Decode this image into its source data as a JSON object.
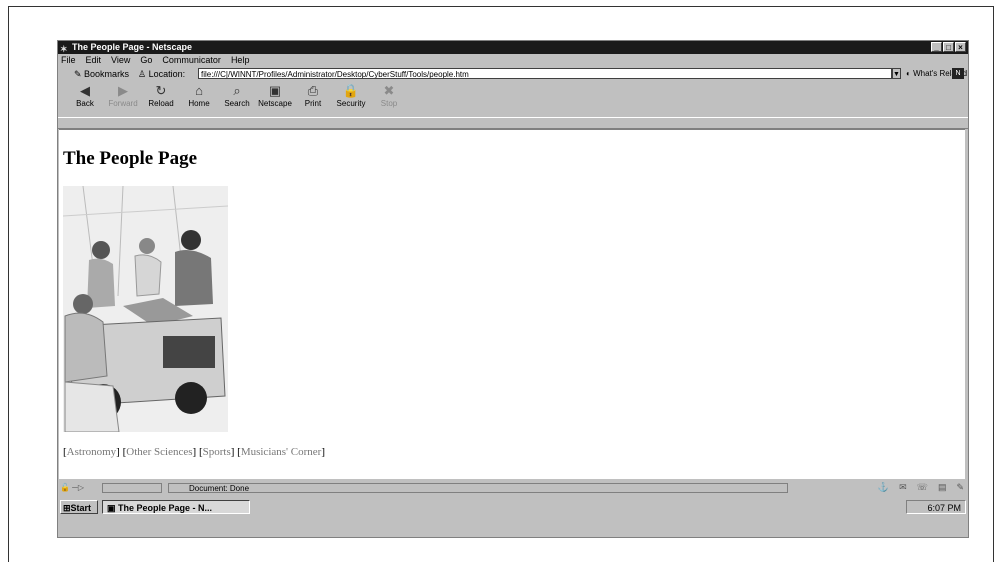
{
  "window": {
    "title": "The People Page - Netscape",
    "controls": [
      "_",
      "□",
      "×"
    ]
  },
  "menu": [
    "File",
    "Edit",
    "View",
    "Go",
    "Communicator",
    "Help"
  ],
  "location": {
    "bookmarks_label": "Bookmarks",
    "location_label": "Location:",
    "url": "file:///C|/WINNT/Profiles/Administrator/Desktop/CyberStuff/Tools/people.htm",
    "related_label": "What's Related"
  },
  "toolbar": [
    {
      "label": "Back",
      "icon": "back-arrow-icon",
      "glyph": "◀",
      "enabled": true
    },
    {
      "label": "Forward",
      "icon": "forward-arrow-icon",
      "glyph": "▶",
      "enabled": false
    },
    {
      "label": "Reload",
      "icon": "reload-icon",
      "glyph": "↻",
      "enabled": true
    },
    {
      "label": "Home",
      "icon": "home-icon",
      "glyph": "⌂",
      "enabled": true
    },
    {
      "label": "Search",
      "icon": "search-icon",
      "glyph": "⌕",
      "enabled": true
    },
    {
      "label": "Netscape",
      "icon": "netscape-icon",
      "glyph": "▣",
      "enabled": true
    },
    {
      "label": "Print",
      "icon": "print-icon",
      "glyph": "⎙",
      "enabled": true
    },
    {
      "label": "Security",
      "icon": "security-lock-icon",
      "glyph": "🔒",
      "enabled": true
    },
    {
      "label": "Stop",
      "icon": "stop-icon",
      "glyph": "✖",
      "enabled": false
    }
  ],
  "page": {
    "heading": "The People Page",
    "links": [
      "Astronomy",
      "Other Sciences",
      "Sports",
      "Musicians' Corner"
    ]
  },
  "status": {
    "message": "Document: Done"
  },
  "taskbar": {
    "start_label": "Start",
    "task_label": "The People Page - N...",
    "time": "6:07 PM"
  }
}
